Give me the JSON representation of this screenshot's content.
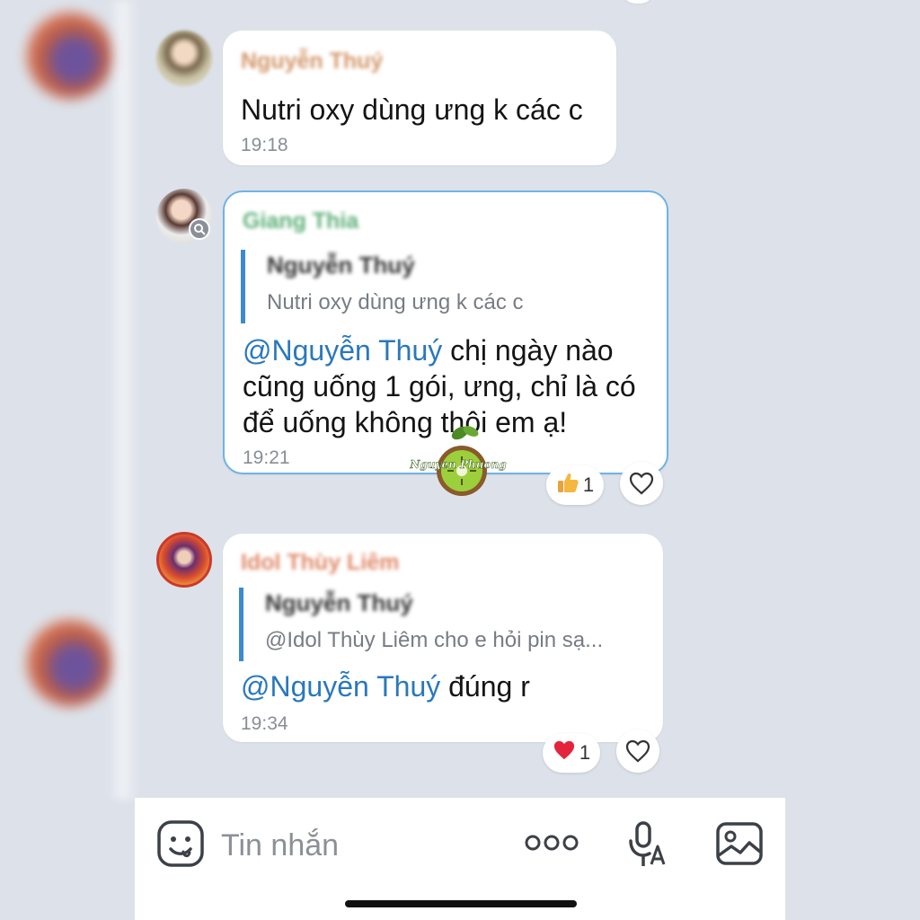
{
  "messages": [
    {
      "sender": "Nguyễn Thuý",
      "text": "Nutri oxy dùng ưng k các c",
      "time": "19:18"
    },
    {
      "sender": "Giang Thia",
      "reply_to": {
        "name": "Nguyễn Thuý",
        "text": "Nutri oxy dùng ưng k các c"
      },
      "mention": "@Nguyễn Thuý",
      "text_lines": [
        " chị ngày nào",
        "cũng uống 1 gói, ưng, chỉ là có",
        "để uống không thôi em ạ!"
      ],
      "time": "19:21",
      "reaction": {
        "icon": "thumbs-up-icon",
        "count": "1"
      }
    },
    {
      "sender": "Idol Thùy Liêm",
      "reply_to": {
        "name": "Nguyễn Thuý",
        "text": "@Idol Thùy Liêm cho e hỏi pin sạ..."
      },
      "mention": "@Nguyễn Thuý",
      "text": " đúng r",
      "time": "19:34",
      "reaction": {
        "icon": "red-heart-icon",
        "count": "1"
      }
    }
  ],
  "watermark": "Nguyen Phuong",
  "input_bar": {
    "placeholder": "Tin nhắn",
    "icons": [
      "sticker-icon",
      "more-icon",
      "voice-text-icon",
      "image-icon"
    ]
  },
  "colors": {
    "background": "#dde2ea",
    "mention": "#2a78bd",
    "quote_bar": "#3b8ad0",
    "selected_border": "#6fb3e6"
  }
}
